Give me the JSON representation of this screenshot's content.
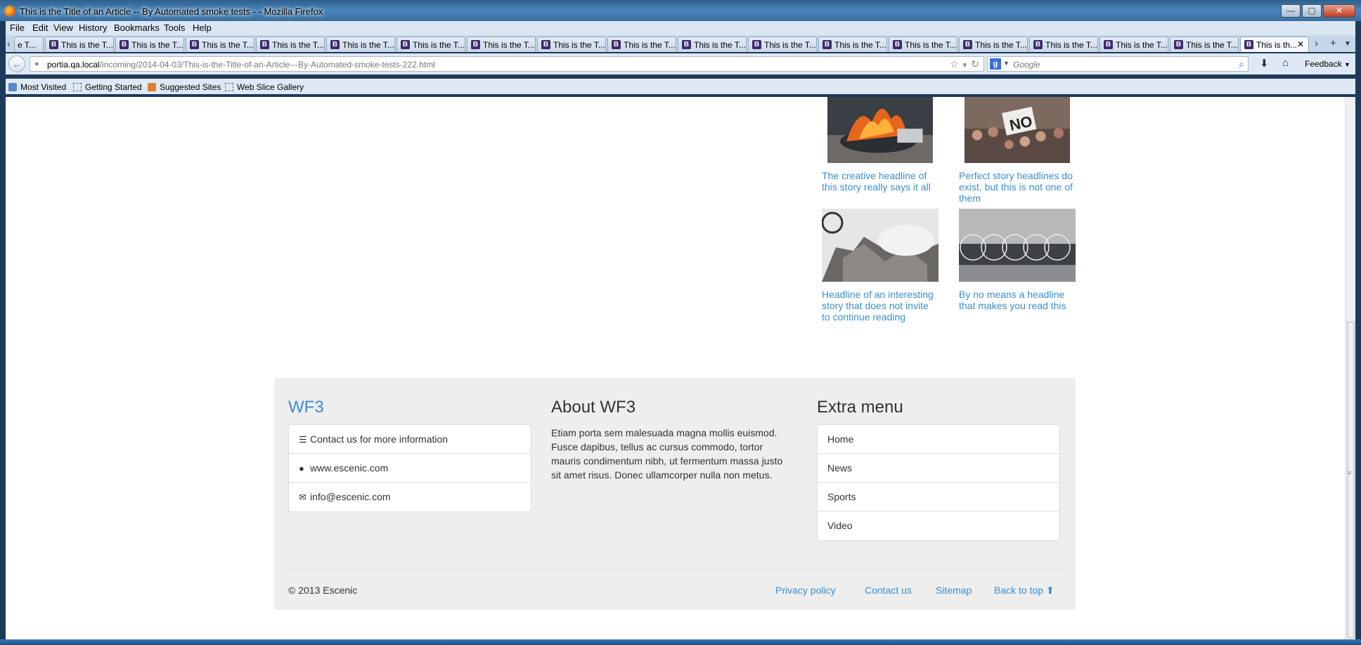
{
  "window": {
    "title": "This is the Title of an Article -- By Automated smoke tests - - Mozilla Firefox",
    "min": "—",
    "max": "▢",
    "close": "✕"
  },
  "menu": [
    "File",
    "Edit",
    "View",
    "History",
    "Bookmarks",
    "Tools",
    "Help"
  ],
  "tabs": {
    "first_partial": "e T...",
    "label": "This is the T...",
    "active_label": "This is th...",
    "favicon_letter": "B",
    "close": "✕",
    "new": "+"
  },
  "nav": {
    "url_host": "portia.qa.local",
    "url_path": "/incoming/2014-04-03/This-is-the-Title-of-an-Article---By-Automated-smoke-tests-222.html",
    "search_placeholder": "Google",
    "feedback": "Feedback"
  },
  "bookmarks": [
    "Most Visited",
    "Getting Started",
    "Suggested Sites",
    "Web Slice Gallery"
  ],
  "stories": [
    {
      "headline": "The creative headline of this story really says it all",
      "image": "burning car"
    },
    {
      "headline": "Perfect story headlines do exist, but this is not one of them",
      "image": "protest crowd with NO sign"
    },
    {
      "headline": "Headline of an interesting story that does not invite to continue reading",
      "image": "demolished building"
    },
    {
      "headline": "By no means a headline that makes you read this",
      "image": "riot police barbed wire"
    }
  ],
  "footer": {
    "brand": "WF3",
    "contacts": [
      {
        "icon": "list-icon",
        "glyph": "☰",
        "text": "Contact us for more information"
      },
      {
        "icon": "globe-icon",
        "glyph": "●",
        "text": "www.escenic.com"
      },
      {
        "icon": "envelope-icon",
        "glyph": "✉",
        "text": "info@escenic.com"
      }
    ],
    "about_title": "About WF3",
    "about_text": "Etiam porta sem malesuada magna mollis euismod. Fusce dapibus, tellus ac cursus commodo, tortor mauris condimentum nibh, ut fermentum massa justo sit amet risus. Donec ullamcorper nulla non metus.",
    "extra_title": "Extra menu",
    "extra_menu": [
      "Home",
      "News",
      "Sports",
      "Video"
    ],
    "copyright": "© 2013 Escenic",
    "links": [
      "Privacy policy",
      "Contact us",
      "Sitemap",
      "Back to top"
    ],
    "back_to_top_arrow": "⬆"
  },
  "colors": {
    "link": "#3b8ed0",
    "footer_bg": "#eeeeee",
    "chrome": "#dfe9f5"
  }
}
